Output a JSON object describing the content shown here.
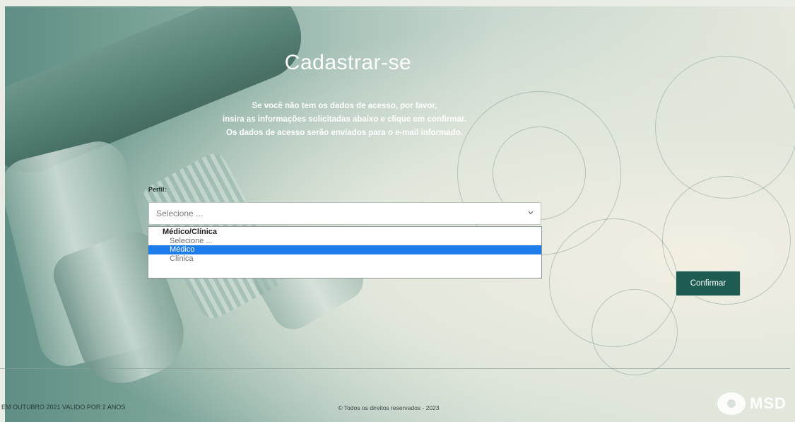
{
  "header": {
    "title": "Cadastrar-se",
    "subtitle_lines": [
      "Se você não tem os dados de acesso, por favor,",
      "insira as informações solicitadas abaixo e clique em confirmar.",
      "Os dados de acesso serão enviados para o e-mail informado."
    ]
  },
  "form": {
    "perfil_label": "Perfil:",
    "select_value": "Selecione ...",
    "dropdown": {
      "group_label": "Médico/Clínica",
      "options": [
        "Selecione ...",
        "Médico",
        "Clínica"
      ],
      "selected": "Médico"
    },
    "confirm_label": "Confirmar"
  },
  "footer": {
    "left_text": "EM OUTUBRO 2021 VALIDO POR 2 ANOS",
    "center_text": "© Todos os direitos reservados - 2023",
    "logo_text": "MSD"
  },
  "colors": {
    "button_bg": "#1e5c52",
    "highlight": "#1e7dea"
  }
}
